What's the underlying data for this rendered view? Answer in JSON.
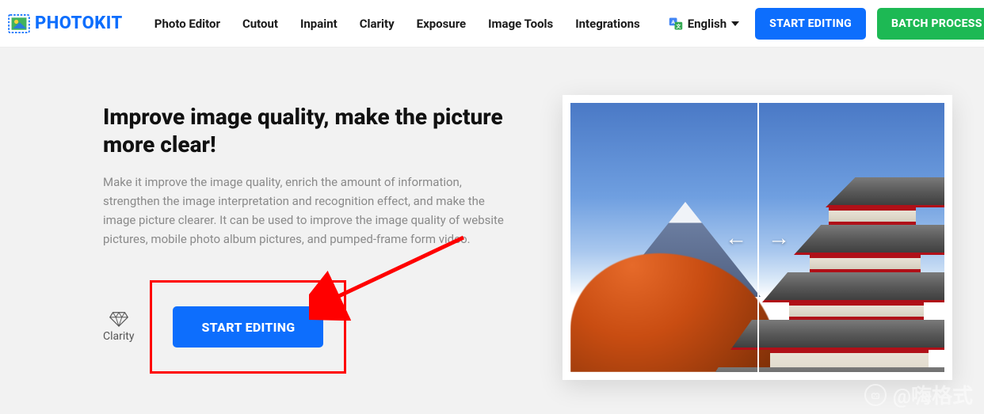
{
  "brand": {
    "name": "PHOTOKIT"
  },
  "nav": {
    "items": [
      {
        "label": "Photo Editor"
      },
      {
        "label": "Cutout"
      },
      {
        "label": "Inpaint"
      },
      {
        "label": "Clarity"
      },
      {
        "label": "Exposure"
      },
      {
        "label": "Image Tools"
      },
      {
        "label": "Integrations"
      }
    ],
    "language": "English"
  },
  "header_actions": {
    "start_editing": "START EDITING",
    "batch_process": "BATCH PROCESS"
  },
  "hero": {
    "title": "Improve image quality, make the picture more clear!",
    "description": "Make it improve the image quality, enrich the amount of information, strengthen the image interpretation and recognition effect, and make the image picture clearer. It can be used to improve the image quality of website pictures, mobile photo album pictures, and pumped-frame form video."
  },
  "feature": {
    "clarity_label": "Clarity",
    "start_editing": "START EDITING"
  },
  "watermark": {
    "text": "@嗨格式"
  },
  "colors": {
    "primary": "#0d6efd",
    "success": "#1db954",
    "annotation": "#ff0000"
  }
}
